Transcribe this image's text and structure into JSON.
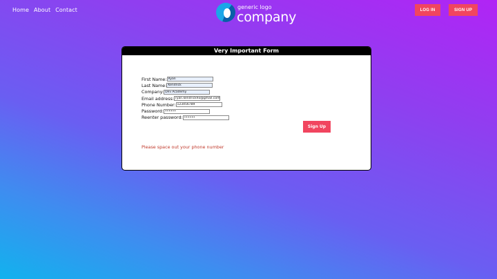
{
  "nav": {
    "home": "Home",
    "about": "About",
    "contact": "Contact"
  },
  "logo": {
    "tagline": "generic logo",
    "name": "company"
  },
  "header": {
    "login_label": "LOG IN",
    "signup_label": "SIGN UP"
  },
  "form": {
    "title": "Very Important Form",
    "fields": {
      "first_name": {
        "label": "First Name:",
        "value": "Ryan"
      },
      "last_name": {
        "label": "Last Name:",
        "value": "Kendrick"
      },
      "company": {
        "label": "Company:",
        "value": "Dev Academy"
      },
      "email": {
        "label": "Email address:",
        "value": "ryan.kendrick93@gmail.com"
      },
      "phone": {
        "label": "Phone Number:",
        "value": "123456789"
      },
      "password": {
        "label": "Password:",
        "value": "••••••"
      },
      "reenter_password": {
        "label": "Reenter password:",
        "value": "••••••"
      }
    },
    "submit_label": "Sign Up",
    "error_message": "Please space out your phone number"
  },
  "colors": {
    "accent": "#f1455f",
    "error": "#c0392b"
  }
}
